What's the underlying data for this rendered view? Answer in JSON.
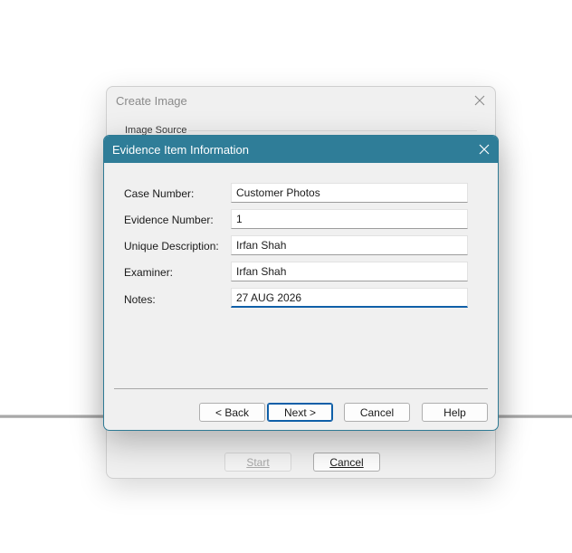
{
  "back_dialog": {
    "title": "Create Image",
    "group_label": "Image Source",
    "buttons": {
      "start_label": "Start",
      "cancel_label": "Cancel"
    }
  },
  "dialog": {
    "title": "Evidence Item Information",
    "fields": [
      {
        "label": "Case Number:",
        "value": "Customer Photos"
      },
      {
        "label": "Evidence Number:",
        "value": "1"
      },
      {
        "label": "Unique Description:",
        "value": "Irfan Shah"
      },
      {
        "label": "Examiner:",
        "value": "Irfan Shah"
      },
      {
        "label": "Notes:",
        "value": "27 AUG 2026"
      }
    ],
    "buttons": {
      "back_label": "< Back",
      "next_label": "Next >",
      "cancel_label": "Cancel",
      "help_label": "Help"
    }
  },
  "colors": {
    "titlebar": "#2f7d98",
    "focus_accent": "#0f5fa8"
  },
  "icons": {
    "close": "close-icon"
  }
}
